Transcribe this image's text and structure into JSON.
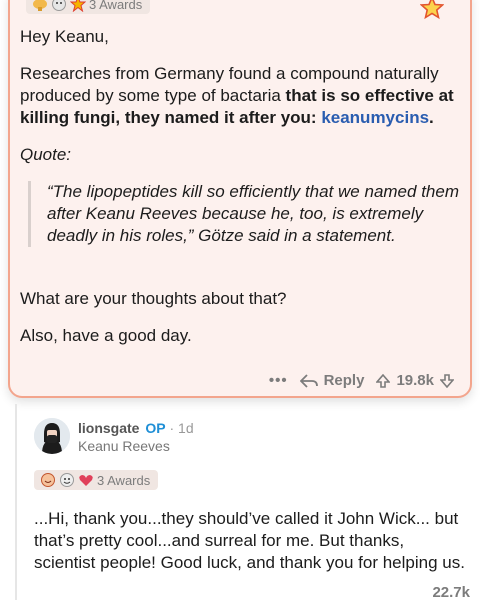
{
  "post": {
    "awards_label": "3 Awards",
    "greeting": "Hey Keanu,",
    "para1_start": "Researches from Germany found a compound naturally produced by some type of bactaria ",
    "para1_bold": "that is so effective at killing fungi, they named it after you: ",
    "para1_link": "keanumycins",
    "para1_end": ".",
    "quote_label": "Quote:",
    "quote_text": "“The lipopeptides kill so efficiently that we named them after Keanu Reeves because he, too, is extremely deadly in his roles,” Götze said in a statement.",
    "question": "What are your thoughts about that?",
    "signoff": "Also, have a good day.",
    "actions": {
      "more": "•••",
      "reply": "Reply",
      "score": "19.8k"
    }
  },
  "comment": {
    "username": "lionsgate",
    "op_badge": "OP",
    "separator": "·",
    "time": "1d",
    "flair": "Keanu Reeves",
    "awards_label": "3 Awards",
    "text": "...Hi, thank you...they should’ve called it John Wick... but that’s pretty cool...and surreal for me. But thanks, scientist people! Good luck, and thank you for helping us.",
    "score_partial": "22.7k"
  },
  "colors": {
    "card_bg": "#fdf1ee",
    "card_border": "#f3a58d",
    "link": "#2a5db0",
    "op": "#1f8fd6"
  },
  "icons": [
    "award-icon",
    "star-award-icon",
    "upvote-icon",
    "downvote-icon",
    "reply-icon",
    "avatar-icon"
  ]
}
